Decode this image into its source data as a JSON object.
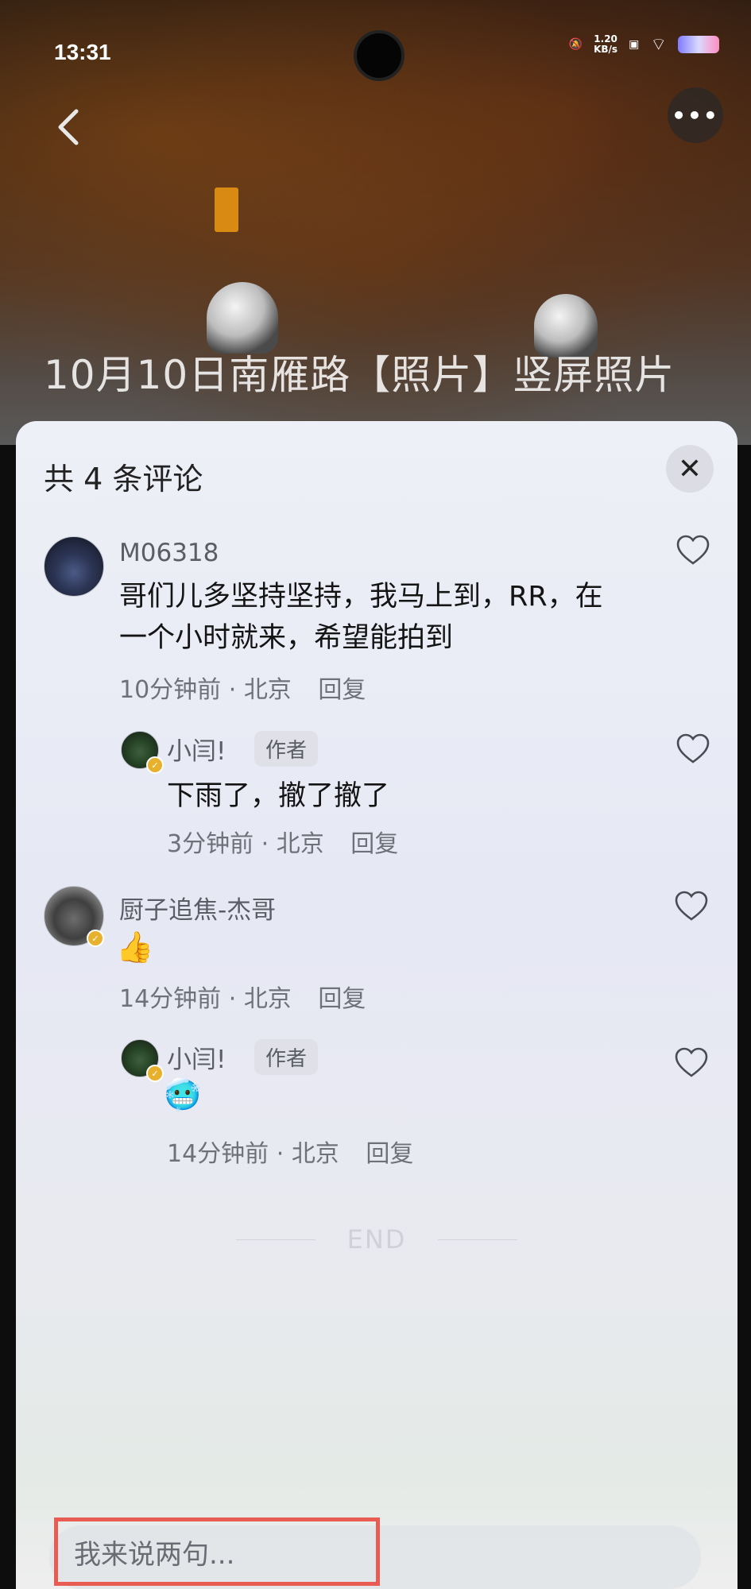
{
  "status_bar": {
    "time": "13:31",
    "net_speed_value": "1.20",
    "net_speed_unit": "KB/s"
  },
  "video": {
    "title": "10月10日南雁路【照片】竖屏照片"
  },
  "comments_sheet": {
    "header": "共 4 条评论",
    "end_text": "END",
    "comments": [
      {
        "username": "M06318",
        "content": "哥们儿多坚持坚持，我马上到，RR，在一个小时就来，希望能拍到",
        "time": "10分钟前",
        "location": "北京",
        "reply_label": "回复"
      },
      {
        "username": "小闫!",
        "tag": "作者",
        "content": "下雨了，撤了撤了",
        "time": "3分钟前",
        "location": "北京",
        "reply_label": "回复"
      },
      {
        "username": "厨子追焦-杰哥",
        "content": "👍",
        "time": "14分钟前",
        "location": "北京",
        "reply_label": "回复"
      },
      {
        "username": "小闫!",
        "tag": "作者",
        "content": "🥶",
        "time": "14分钟前",
        "location": "北京",
        "reply_label": "回复"
      }
    ]
  },
  "input": {
    "placeholder": "我来说两句..."
  },
  "colors": {
    "highlight_border": "#e85c54",
    "author_badge": "#e8b12d"
  }
}
